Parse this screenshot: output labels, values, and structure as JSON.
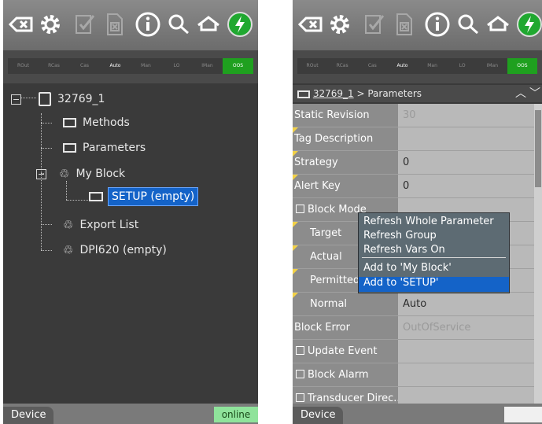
{
  "modes": [
    "ROut",
    "RCas",
    "Cas",
    "Auto",
    "Man",
    "LO",
    "IMan",
    "OOS"
  ],
  "left": {
    "tree": {
      "root": "32769_1",
      "methods": "Methods",
      "parameters": "Parameters",
      "my_block": "My Block",
      "setup": "SETUP (empty)",
      "export": "Export List",
      "dpi": "DPI620 (empty)"
    },
    "status": {
      "tab": "Device",
      "online": "online"
    }
  },
  "right": {
    "path_link": "32769_1",
    "path_suffix": "> Parameters",
    "rows": [
      {
        "name": "Static Revision",
        "value": "30",
        "dim": true
      },
      {
        "name": "Tag Description",
        "value": ""
      },
      {
        "name": "Strategy",
        "value": "0"
      },
      {
        "name": "Alert Key",
        "value": "0"
      },
      {
        "name": "Block Mode",
        "value": ""
      },
      {
        "name": "Target",
        "value": ""
      },
      {
        "name": "Actual",
        "value": ""
      },
      {
        "name": "Permitted",
        "value": ""
      },
      {
        "name": "Normal",
        "value": "Auto"
      },
      {
        "name": "Block Error",
        "value": "OutOfService",
        "dim": true
      },
      {
        "name": "Update Event",
        "value": ""
      },
      {
        "name": "Block Alarm",
        "value": ""
      },
      {
        "name": "Transducer Direc...",
        "value": ""
      }
    ],
    "context_menu": {
      "refresh_whole": "Refresh Whole Parameter",
      "refresh_group": "Refresh Group",
      "refresh_vars": "Refresh Vars On",
      "add_my_block": "Add to 'My Block'",
      "add_setup": "Add to 'SETUP'"
    },
    "status": {
      "tab": "Device"
    }
  }
}
